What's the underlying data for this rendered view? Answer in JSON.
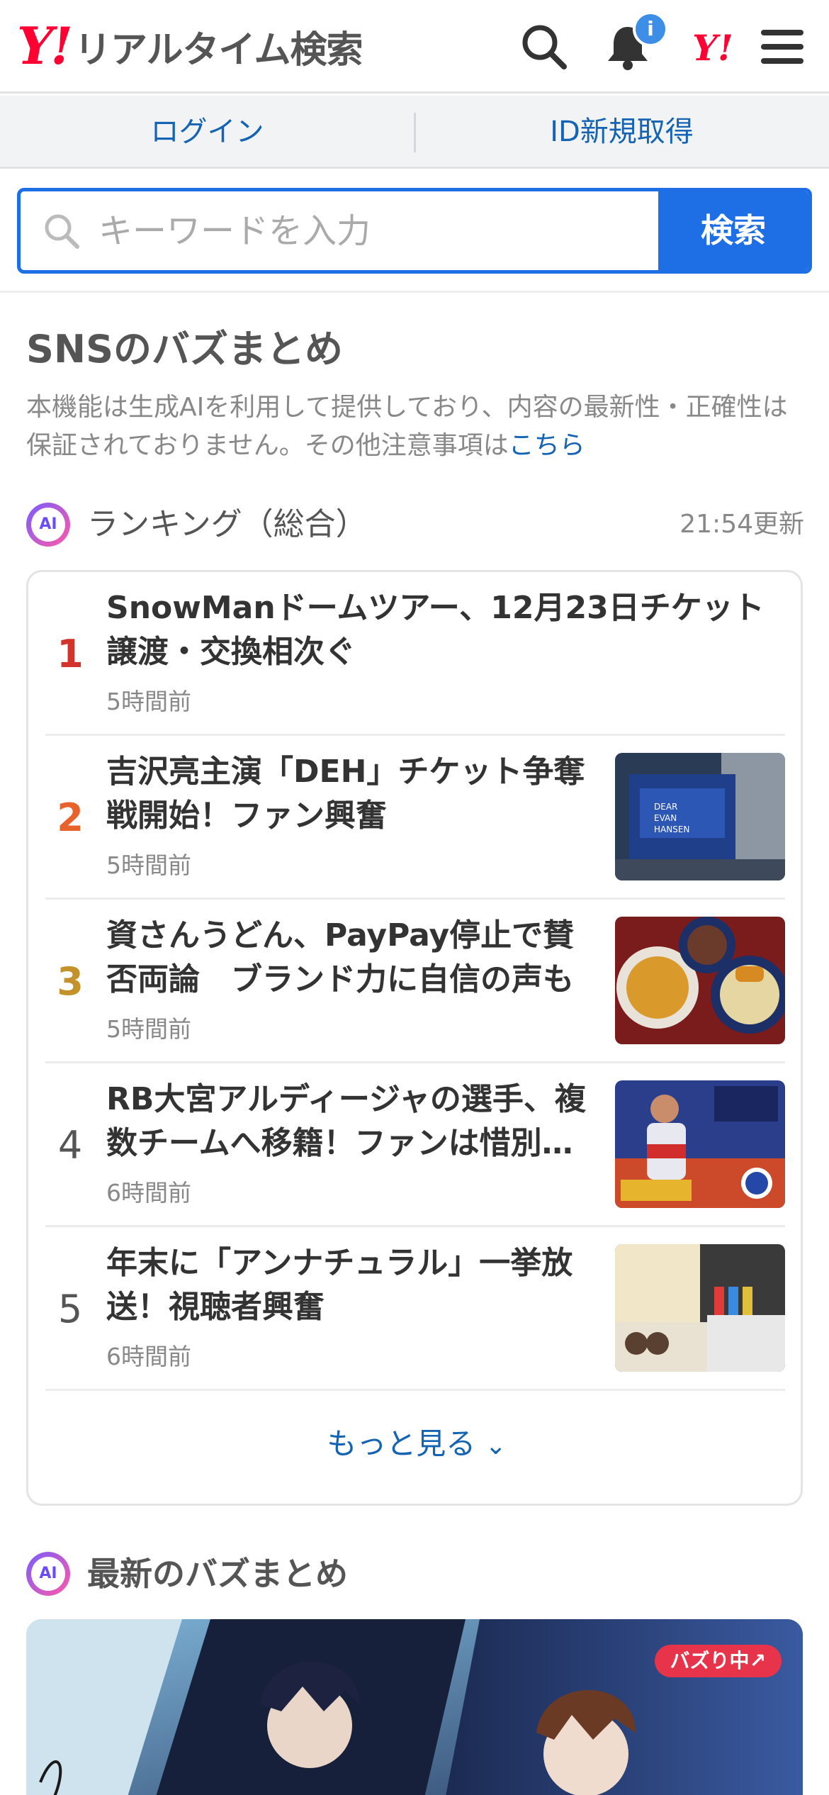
{
  "header": {
    "logo_mark": "Y!",
    "logo_text": "リアルタイム検索",
    "notification_badge": "i",
    "yahoo_icon": "Y!"
  },
  "login_bar": {
    "login": "ログイン",
    "register": "ID新規取得"
  },
  "search": {
    "placeholder": "キーワードを入力",
    "button": "検索"
  },
  "section": {
    "title": "SNSのバズまとめ",
    "disclaimer": "本機能は生成AIを利用して提供しており、内容の最新性・正確性は保証されておりません。その他注意事項は",
    "disclaimer_link": "こちら"
  },
  "ranking": {
    "ai_label": "AI",
    "title": "ランキング（総合）",
    "updated": "21:54更新",
    "items": [
      {
        "rank": "1",
        "text": "SnowManドームツアー、12月23日チケット譲渡・交換相次ぐ",
        "time": "5時間前",
        "color": "#d2332a"
      },
      {
        "rank": "2",
        "text": "吉沢亮主演「DEH」チケット争奪戦開始！ファン興奮",
        "time": "5時間前",
        "color": "#e8622c"
      },
      {
        "rank": "3",
        "text": "資さんうどん、PayPay停止で賛否両論　ブランド力に自信の声も",
        "time": "5時間前",
        "color": "#c4922a"
      },
      {
        "rank": "4",
        "text": "RB大宮アルディージャの選手、複数チームへ移籍！ファンは惜別…",
        "time": "6時間前",
        "color": "#555555"
      },
      {
        "rank": "5",
        "text": "年末に「アンナチュラル」一挙放送！視聴者興奮",
        "time": "6時間前",
        "color": "#555555"
      }
    ],
    "more": "もっと見る"
  },
  "latest": {
    "ai_label": "AI",
    "title": "最新のバズまとめ",
    "badge": "バズり中↗"
  }
}
